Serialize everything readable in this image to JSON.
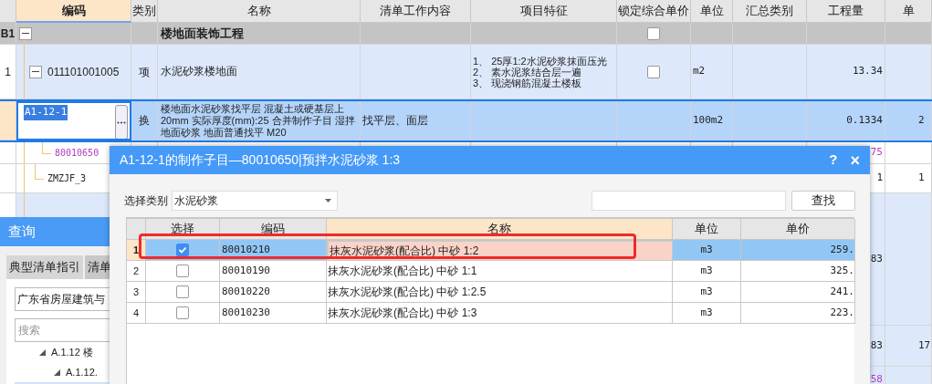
{
  "main_grid": {
    "columns": [
      {
        "label": "编码",
        "selected": true
      },
      {
        "label": "类别",
        "selected": false
      },
      {
        "label": "名称",
        "selected": false
      },
      {
        "label": "清单工作内容",
        "selected": false
      },
      {
        "label": "项目特征",
        "selected": false
      },
      {
        "label": "锁定综合单价",
        "selected": false
      },
      {
        "label": "单位",
        "selected": false
      },
      {
        "label": "汇总类别",
        "selected": false
      },
      {
        "label": "工程量",
        "selected": false
      },
      {
        "label": "单",
        "selected": false
      }
    ],
    "rows": [
      {
        "kind": "section",
        "row_number": "B1",
        "expanded": true,
        "name": "楼地面装饰工程",
        "locked": false,
        "selected": false
      },
      {
        "kind": "item",
        "row_number": "1",
        "expanded": true,
        "code": "011101001005",
        "type": "项",
        "name": "水泥砂浆楼地面",
        "features": "1、 25厚1:2水泥砂浆抹面压光\n2、 素水泥浆结合层一遍\n3、 现浇钢筋混凝土楼板",
        "locked": false,
        "unit": "m2",
        "quantity": "13.34",
        "selected": false
      },
      {
        "kind": "sub",
        "code": "A1-12-1",
        "type": "换",
        "name": "楼地面水泥砂浆找平层 混凝土或硬基层上 20mm  实际厚度(mm):25  合并制作子目 湿拌地面砂浆 地面普通找平 M20",
        "content": "找平层、面层",
        "unit": "100m2",
        "quantity": "0.1334",
        "price": "2",
        "selected": true
      },
      {
        "kind": "material",
        "code": "80010650",
        "color": "#b040c0",
        "quantity": "75",
        "selected": false
      },
      {
        "kind": "material",
        "code": "ZMZJF_3",
        "color": "#222222",
        "quantity": "1",
        "price": "1",
        "selected": false
      },
      {
        "kind": "blank",
        "quantity": "83",
        "selected": false
      },
      {
        "kind": "blank",
        "quantity": "83",
        "price": "17",
        "selected": false
      },
      {
        "kind": "blank",
        "quantity": "58",
        "color": "#b040c0",
        "selected": false
      }
    ]
  },
  "query_panel": {
    "title": "查询",
    "tabs": [
      {
        "label": "典型清单指引",
        "selected": true
      },
      {
        "label": "清单",
        "selected": false
      }
    ],
    "library": "广东省房屋建筑与",
    "search": {
      "placeholder": "搜索"
    },
    "tree": [
      {
        "label": "A.1.12 楼",
        "expanded": true,
        "children": [
          {
            "label": "A.1.12."
          }
        ]
      }
    ]
  },
  "dialog": {
    "title": "A1-12-1的制作子目—80010650|预拌水泥砂浆 1:3",
    "help": "?",
    "close": "×",
    "category_label": "选择类别",
    "category": "水泥砂浆",
    "find_button": "查找",
    "columns": [
      "选择",
      "编码",
      "名称",
      "单位",
      "单价"
    ],
    "rows": [
      {
        "number": "1",
        "checked": true,
        "code": "80010210",
        "name": "抹灰水泥砂浆(配合比) 中砂 1:2",
        "unit": "m3",
        "price": "259.",
        "selected": true
      },
      {
        "number": "2",
        "checked": false,
        "code": "80010190",
        "name": "抹灰水泥砂浆(配合比) 中砂 1:1",
        "unit": "m3",
        "price": "325.",
        "selected": false
      },
      {
        "number": "3",
        "checked": false,
        "code": "80010220",
        "name": "抹灰水泥砂浆(配合比) 中砂 1:2.5",
        "unit": "m3",
        "price": "241.",
        "selected": false
      },
      {
        "number": "4",
        "checked": false,
        "code": "80010230",
        "name": "抹灰水泥砂浆(配合比) 中砂 1:3",
        "unit": "m3",
        "price": "223.",
        "selected": false
      }
    ],
    "highlight_frame": true
  }
}
